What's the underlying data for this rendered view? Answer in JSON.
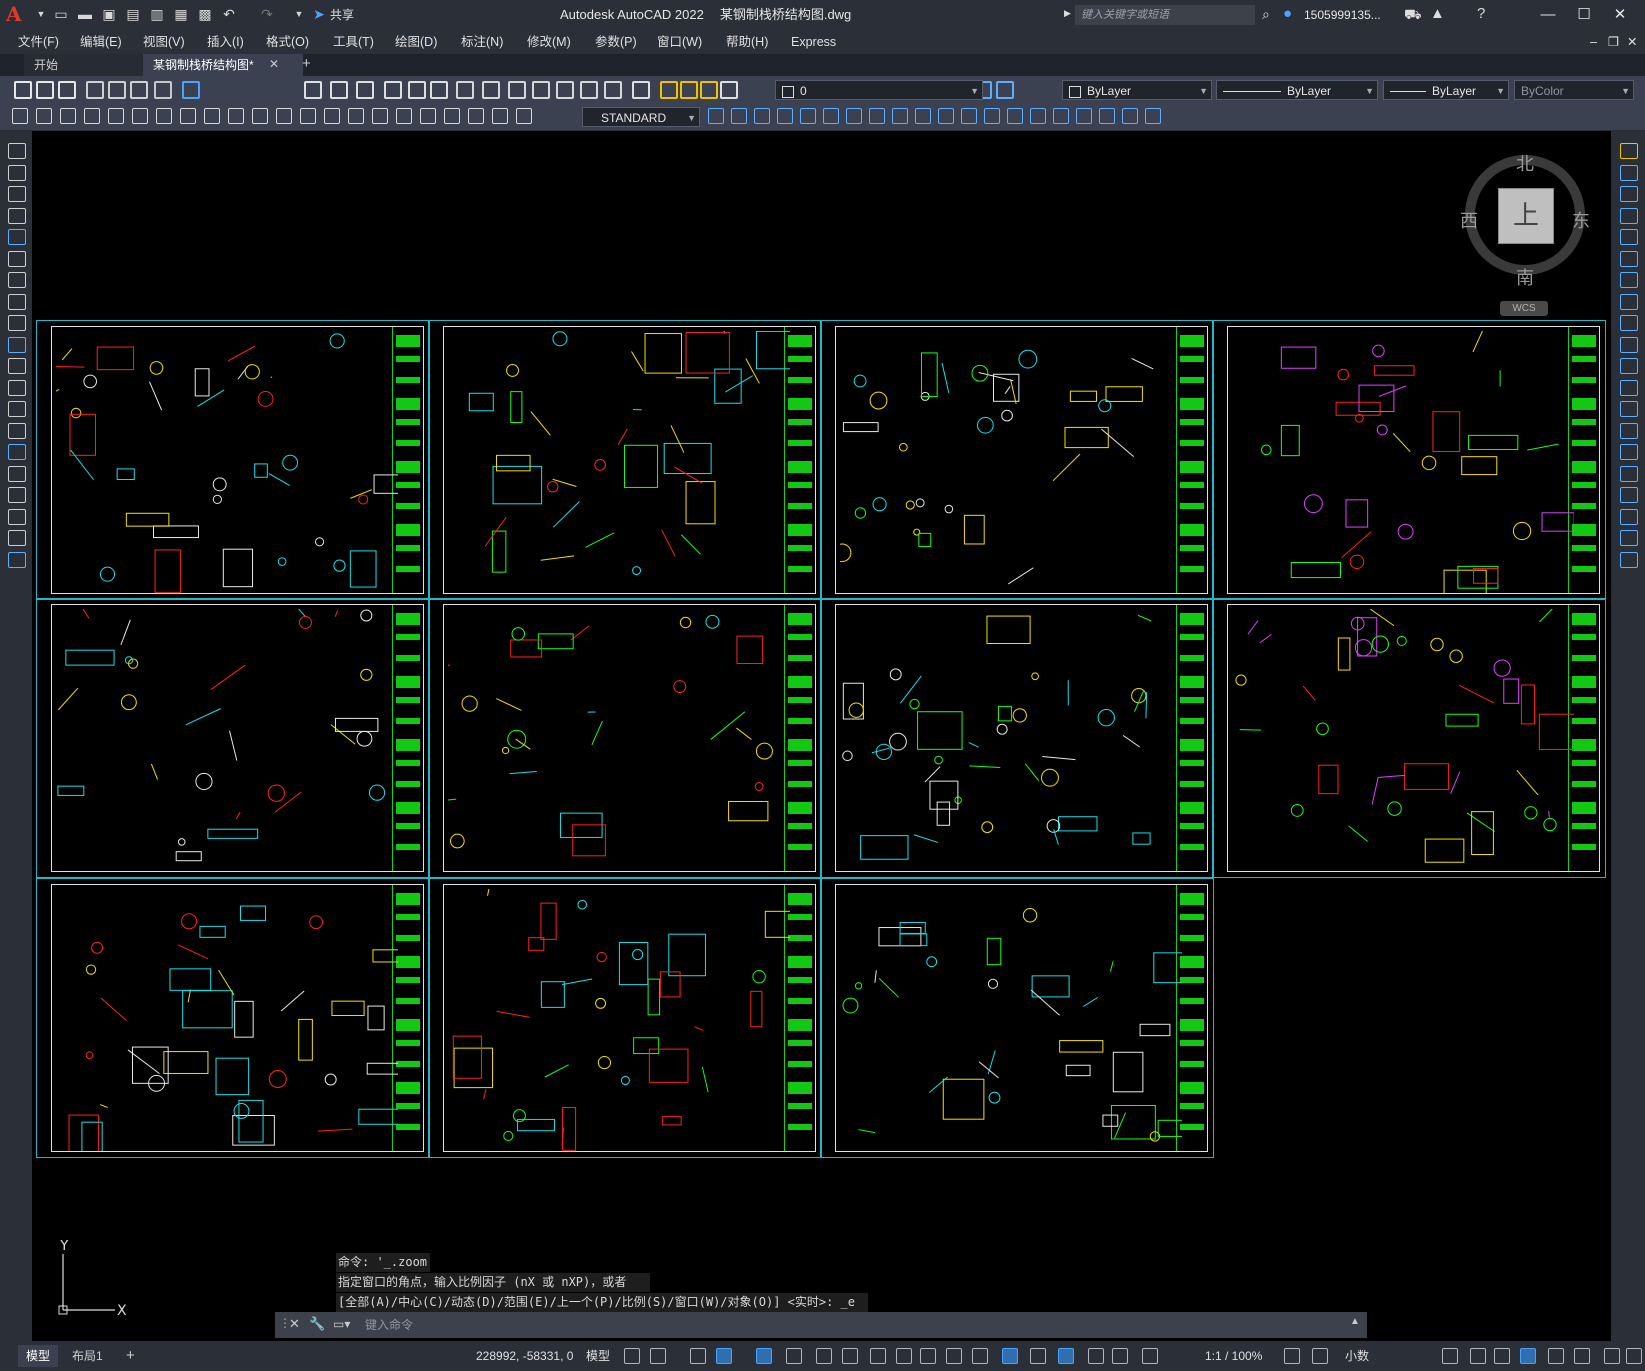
{
  "app": {
    "title": "Autodesk AutoCAD 2022",
    "filename": "某钢制栈桥结构图.dwg",
    "search_placeholder": "键入关键字或短语",
    "user": "1505999135...",
    "share": "共享"
  },
  "menu": [
    "文件(F)",
    "编辑(E)",
    "视图(V)",
    "插入(I)",
    "格式(O)",
    "工具(T)",
    "绘图(D)",
    "标注(N)",
    "修改(M)",
    "参数(P)",
    "窗口(W)",
    "帮助(H)",
    "Express"
  ],
  "tabs": {
    "start": "开始",
    "document": "某钢制栈桥结构图*"
  },
  "toolbar": {
    "layer": "0",
    "color": "ByLayer",
    "linetype": "ByLayer",
    "lineweight": "ByLayer",
    "plotstyle": "ByColor",
    "textstyle": "STANDARD"
  },
  "viewcube": {
    "top": "上",
    "north": "北",
    "south": "南",
    "east": "东",
    "west": "西",
    "wcs": "WCS"
  },
  "ucs": {
    "x": "X",
    "y": "Y"
  },
  "command": {
    "history": [
      "命令: '_.zoom",
      "指定窗口的角点，输入比例因子 (nX 或 nXP)，或者",
      "[全部(A)/中心(C)/动态(D)/范围(E)/上一个(P)/比例(S)/窗口(W)/对象(O)] <实时>: _e"
    ],
    "placeholder": "键入命令"
  },
  "status": {
    "layouts": [
      "模型",
      "布局1"
    ],
    "coords": "228992, -58331, 0",
    "mode": "模型",
    "scale": "1:1 / 100%",
    "units": "小数"
  },
  "colors": {
    "cyan_border": "#20b7c6",
    "titleblock_green": "#12c812",
    "ui_bg": "#2b2f38",
    "toolbar_bg": "#3b4150"
  }
}
